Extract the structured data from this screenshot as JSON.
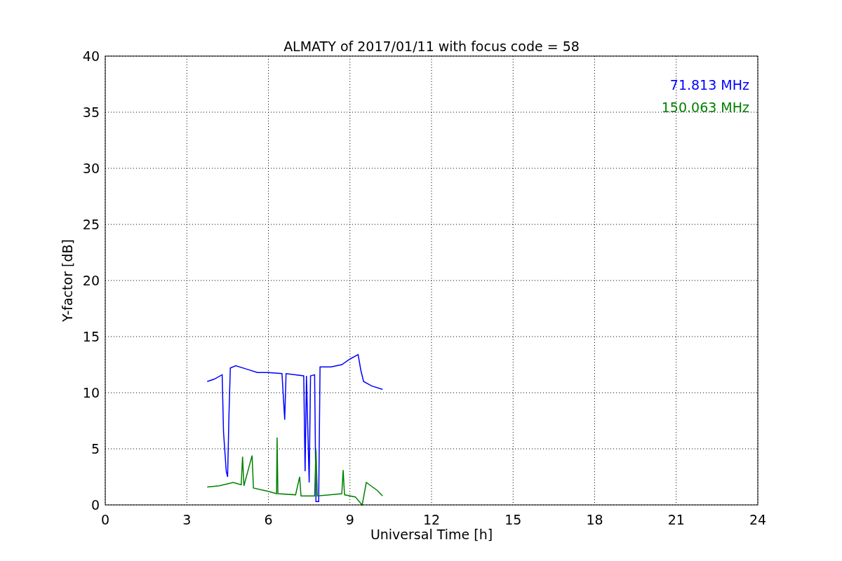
{
  "figure": {
    "chart_data": {
      "type": "line",
      "title": "ALMATY of 2017/01/11 with focus code = 58",
      "xlabel": "Universal Time [h]",
      "ylabel": "Y-factor [dB]",
      "xlim": [
        0,
        24
      ],
      "ylim": [
        0,
        40
      ],
      "xticks": [
        0,
        3,
        6,
        9,
        12,
        15,
        18,
        21,
        24
      ],
      "yticks": [
        0,
        5,
        10,
        15,
        20,
        25,
        30,
        35,
        40
      ],
      "grid": true,
      "series": [
        {
          "name": "71.813 MHz",
          "color": "#0000ff",
          "x": [
            3.75,
            4.0,
            4.3,
            4.35,
            4.45,
            4.5,
            4.55,
            4.6,
            4.8,
            5.2,
            5.6,
            6.0,
            6.5,
            6.6,
            6.65,
            7.0,
            7.3,
            7.35,
            7.4,
            7.5,
            7.55,
            7.7,
            7.75,
            7.85,
            7.9,
            8.3,
            8.7,
            9.0,
            9.3,
            9.4,
            9.5,
            9.8,
            10.2
          ],
          "values": [
            11.0,
            11.2,
            11.6,
            6.5,
            3.0,
            2.5,
            8.0,
            12.2,
            12.4,
            12.1,
            11.8,
            11.8,
            11.7,
            7.6,
            11.7,
            11.6,
            11.5,
            3.0,
            11.5,
            2.0,
            11.5,
            11.6,
            0.3,
            0.3,
            12.3,
            12.3,
            12.5,
            13.0,
            13.4,
            12.0,
            11.0,
            10.6,
            10.3
          ]
        },
        {
          "name": "150.063 MHz",
          "color": "#008000",
          "x": [
            3.75,
            4.2,
            4.7,
            5.0,
            5.05,
            5.1,
            5.4,
            5.45,
            6.0,
            6.3,
            6.32,
            6.35,
            7.0,
            7.15,
            7.2,
            7.7,
            7.75,
            7.8,
            8.3,
            8.7,
            8.75,
            8.8,
            9.2,
            9.45,
            9.6,
            10.0,
            10.2
          ],
          "values": [
            1.6,
            1.7,
            2.0,
            1.8,
            4.3,
            1.7,
            4.4,
            1.5,
            1.2,
            1.0,
            6.0,
            1.0,
            0.9,
            2.5,
            0.8,
            0.8,
            4.9,
            0.8,
            0.9,
            1.0,
            3.1,
            0.9,
            0.7,
            0.0,
            2.0,
            1.3,
            0.8
          ]
        }
      ]
    }
  }
}
